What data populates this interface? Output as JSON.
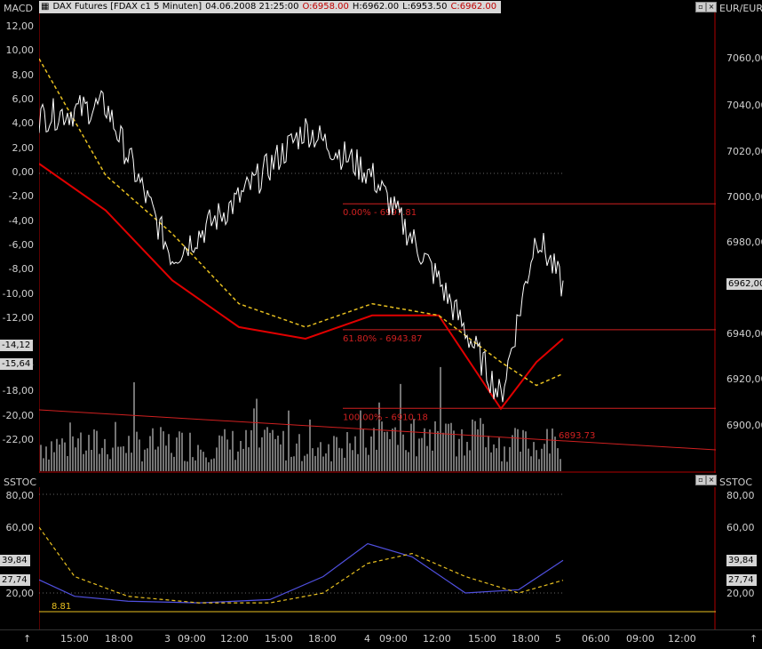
{
  "main_panel": {
    "indicator": "MACD",
    "title": "DAX Futures [FDAX c1  5 Minuten]",
    "datetime": "04.06.2008 21:25:00",
    "ohlc": {
      "open": "O:6958.00",
      "high": "H:6962.00",
      "low": "L:6953.50",
      "close": "C:6962.00"
    },
    "currency": "EUR/EUR",
    "left_axis": [
      "12,00",
      "10,00",
      "8,00",
      "6,00",
      "4,00",
      "2,00",
      "0,00",
      "-2,00",
      "-4,00",
      "-6,00",
      "-8,00",
      "-10,00",
      "-12,00",
      "-14,12",
      "-15,64",
      "-18,00",
      "-20,00",
      "-22,00"
    ],
    "right_axis": [
      "7060,00",
      "7040,00",
      "7020,00",
      "7000,00",
      "6980,00",
      "6962,00",
      "6940,00",
      "6920,00",
      "6900,00"
    ],
    "left_badges": [
      "-14,12",
      "-15,64"
    ],
    "price_badge": "6962,00",
    "fib_levels": [
      {
        "label": "0.00% - 6997.81",
        "value": 6997.81
      },
      {
        "label": "61.80% - 6943.87",
        "value": 6943.87
      },
      {
        "label": "100.00% - 6910.18",
        "value": 6910.18
      }
    ],
    "trendline_label": "6893.73"
  },
  "lower_panel": {
    "indicator": "SSTOC",
    "left_axis": [
      "80,00",
      "60,00",
      "39,84",
      "27,74",
      "20,00"
    ],
    "right_axis": [
      "80,00",
      "60,00",
      "39,84",
      "27,74",
      "20,00"
    ],
    "badges": [
      "39,84",
      "27,74"
    ],
    "level_label": "8.81"
  },
  "time_axis": [
    "15:00",
    "18:00",
    "3",
    "09:00",
    "12:00",
    "15:00",
    "18:00",
    "4",
    "09:00",
    "12:00",
    "15:00",
    "18:00",
    "5",
    "06:00",
    "09:00",
    "12:00"
  ],
  "colors": {
    "background": "#000000",
    "price": "#ffffff",
    "ma_red": "#e00000",
    "ma_yellow": "#e8c020",
    "fib": "#d02020",
    "stoch_blue": "#5050e0",
    "volume": "#e8e8e8"
  },
  "chart_data": {
    "type": "line",
    "title": "DAX Futures [FDAX c1  5 Minuten]",
    "x": [
      "15:00",
      "18:00",
      "3 09:00",
      "12:00",
      "15:00",
      "18:00",
      "4 09:00",
      "12:00",
      "15:00",
      "18:00"
    ],
    "series": [
      {
        "values": [
          7035,
          7040,
          6975,
          7000,
          7030,
          7010,
          6965,
          6915,
          6985,
          6962
        ]
      },
      {
        "values": [
          7015,
          6995,
          6965,
          6945,
          6940,
          6950,
          6950,
          6910,
          6930,
          6940
        ]
      },
      {
        "values": [
          7060,
          7010,
          6985,
          6955,
          6945,
          6955,
          6950,
          6930,
          6920,
          6925
        ]
      }
    ],
    "ylim": [
      6885,
      7070
    ]
  }
}
